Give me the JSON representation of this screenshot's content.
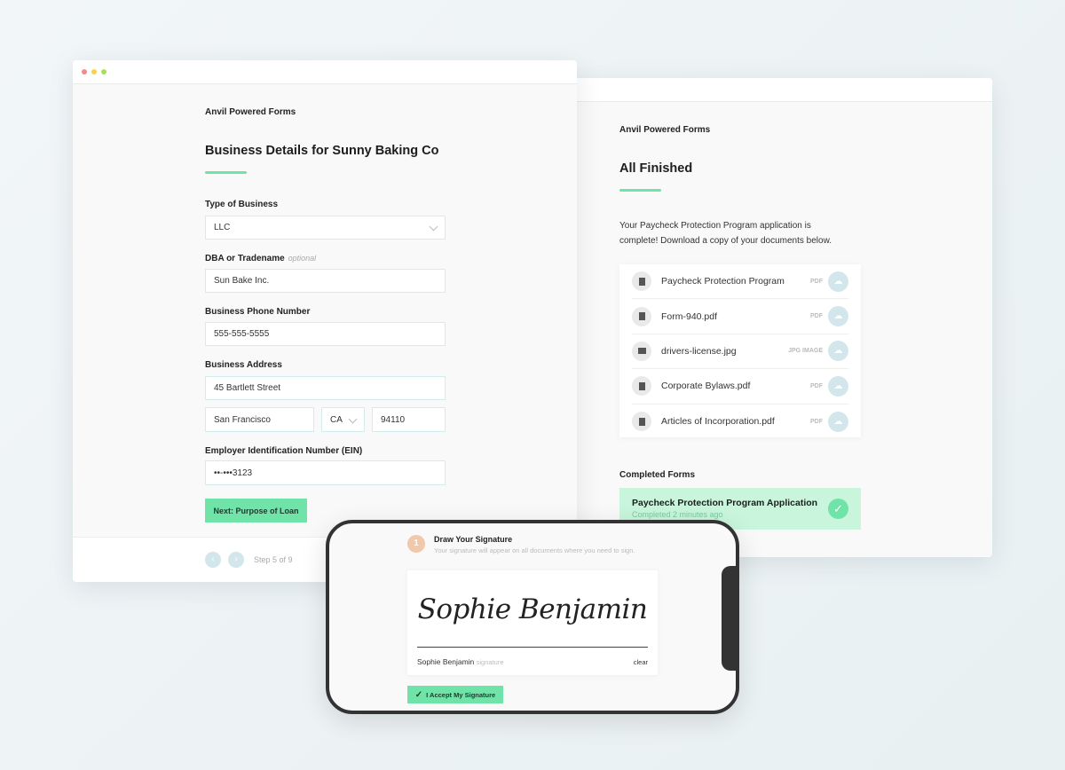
{
  "left_window": {
    "brand": "Anvil Powered Forms",
    "title": "Business Details for Sunny Baking Co",
    "fields": {
      "type_label": "Type of Business",
      "type_value": "LLC",
      "dba_label": "DBA or Tradename",
      "dba_optional": "optional",
      "dba_value": "Sun Bake Inc.",
      "phone_label": "Business Phone Number",
      "phone_value": "555-555-5555",
      "address_label": "Business Address",
      "street_value": "45 Bartlett Street",
      "city_value": "San Francisco",
      "state_value": "CA",
      "zip_value": "94110",
      "ein_label": "Employer Identification Number (EIN)",
      "ein_value": "••-•••3123"
    },
    "next_button": "Next: Purpose of Loan",
    "step_text": "Step 5 of 9"
  },
  "right_window": {
    "brand": "Anvil Powered Forms",
    "title": "All Finished",
    "message_line1": "Your Paycheck Protection Program application is",
    "message_line2": "complete! Download a copy of your documents below.",
    "documents": [
      {
        "name": "Paycheck Protection Program",
        "type": "PDF",
        "icon": "file-icon"
      },
      {
        "name": "Form-940.pdf",
        "type": "PDF",
        "icon": "file-icon"
      },
      {
        "name": "drivers-license.jpg",
        "type": "JPG IMAGE",
        "icon": "image-icon"
      },
      {
        "name": "Corporate Bylaws.pdf",
        "type": "PDF",
        "icon": "file-icon"
      },
      {
        "name": "Articles of Incorporation.pdf",
        "type": "PDF",
        "icon": "file-icon"
      }
    ],
    "completed_heading": "Completed Forms",
    "completed_form": {
      "title": "Paycheck Protection Program Application",
      "subtitle": "Completed 2 minutes ago"
    }
  },
  "phone": {
    "step_number": "1",
    "title": "Draw Your Signature",
    "subtitle": "Your signature will appear on all documents where you need to sign.",
    "signature_drawing": "Sophie Benjamin",
    "signer_name": "Sophie Benjamin",
    "signer_hint": "signature",
    "clear_label": "clear",
    "accept_button": "I Accept My Signature"
  },
  "colors": {
    "accent": "#6fe3a8",
    "completed_bg": "#c9f5dc",
    "step_circle": "#f0c9ad"
  }
}
